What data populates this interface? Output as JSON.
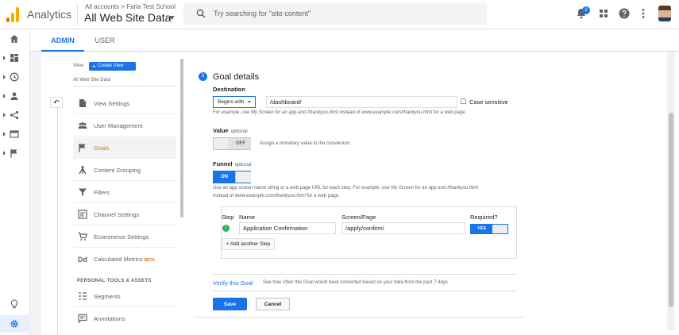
{
  "app": {
    "name": "Analytics"
  },
  "header": {
    "breadcrumb": "All accounts > Faria Test School",
    "view_name": "All Web Site Data",
    "search_placeholder": "Try searching for \"site content\"",
    "notification_count": "2"
  },
  "tabs": [
    {
      "label": "ADMIN"
    },
    {
      "label": "USER"
    }
  ],
  "view_panel": {
    "view_label": "View",
    "create_view_label": "Create View",
    "account_view": "All Web Site Data",
    "menu": [
      {
        "label": "View Settings",
        "icon": "document-icon"
      },
      {
        "label": "User Management",
        "icon": "users-icon"
      },
      {
        "label": "Goals",
        "icon": "flag-icon",
        "active": true
      },
      {
        "label": "Content Grouping",
        "icon": "content-grouping-icon"
      },
      {
        "label": "Filters",
        "icon": "filter-icon"
      },
      {
        "label": "Channel Settings",
        "icon": "channel-icon"
      },
      {
        "label": "Ecommerce Settings",
        "icon": "cart-icon"
      },
      {
        "label": "Calculated Metrics",
        "icon": "calculated-metrics-icon",
        "badge": "BETA"
      }
    ],
    "section_header": "PERSONAL TOOLS & ASSETS",
    "personal_menu": [
      {
        "label": "Segments",
        "icon": "segments-icon"
      },
      {
        "label": "Annotations",
        "icon": "annotations-icon"
      }
    ]
  },
  "goal_details": {
    "step_number": "3",
    "title": "Goal details",
    "destination": {
      "label": "Destination",
      "match_type": "Begins with",
      "value": "/dashboard/",
      "case_sensitive_label": "Case sensitive",
      "help_prefix": "For example, use ",
      "help_em1": "My Screen",
      "help_mid1": " for an app and ",
      "help_em2": "/thankyou.html",
      "help_mid2": " instead of ",
      "help_em3": "www.example.com/thankyou.html",
      "help_suffix": " for a web page."
    },
    "value": {
      "label": "Value",
      "optional": "optional",
      "toggle": "OFF",
      "help": "Assign a monetary value to the conversion."
    },
    "funnel": {
      "label": "Funnel",
      "optional": "optional",
      "toggle": "ON",
      "help_prefix": "Use an app screen name string or a web page URL for each step. For example, use ",
      "help_em1": "My Screen",
      "help_mid1": " for an app and ",
      "help_em2": "/thankyou.html",
      "help_line2_prefix": "instead of ",
      "help_em3": "www.example.com/thankyou.html",
      "help_suffix": " for a web page.",
      "headers": {
        "step": "Step",
        "name": "Name",
        "screen": "Screen/Page",
        "required": "Required?"
      },
      "steps": [
        {
          "number": "1",
          "name": "Application Confirmation",
          "screen": "/apply/confirm/",
          "required": "YES"
        }
      ],
      "add_step_label": "+ Add another Step"
    },
    "verify": {
      "link": "Verify this Goal",
      "desc": "See how often this Goal would have converted based on your data from the past 7 days."
    },
    "save_label": "Save",
    "cancel_label": "Cancel"
  },
  "colors": {
    "accent": "#1a73e8",
    "active_menu": "#e8710a",
    "step_ok": "#34a853"
  }
}
